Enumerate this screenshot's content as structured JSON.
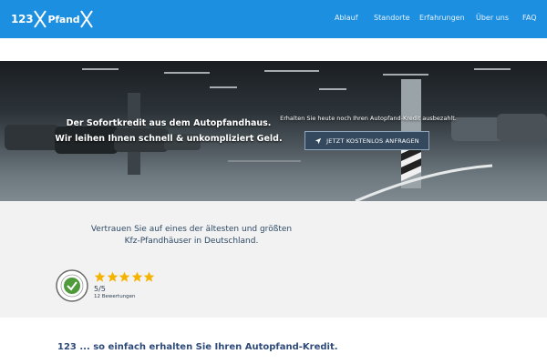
{
  "header": {
    "logo": {
      "left_text": "123",
      "right_text": "Pfand"
    },
    "nav": [
      "Ablauf",
      "Standorte",
      "Erfahrungen",
      "Über uns",
      "FAQ"
    ]
  },
  "hero": {
    "headline_line1": "Der Sofortkredit aus dem Autopfandhaus.",
    "headline_line2": "Wir leihen Ihnen schnell & unkompliziert Geld.",
    "subtext": "Erhalten Sie heute noch Ihren Autopfand-Kredit ausbezahlt.",
    "cta_label": "JETZT KOSTENLOS ANFRAGEN"
  },
  "trust": {
    "text_line1": "Vertrauen Sie auf eines der ältesten und größten",
    "text_line2": "Kfz-Pfandhäuser in Deutschland.",
    "rating": "5/5",
    "reviews": "12 Bewertungen",
    "stars": 5
  },
  "steps": {
    "title": "123 ... so einfach erhalten Sie Ihren Autopfand-Kredit."
  },
  "colors": {
    "header_bg": "#1d8fe1",
    "star": "#f5b301",
    "cta_bg": "#34495e",
    "section_bg": "#f2f2f2"
  },
  "icons": [
    "x-logo-icon",
    "send-icon",
    "star-icon",
    "trust-seal-icon"
  ]
}
